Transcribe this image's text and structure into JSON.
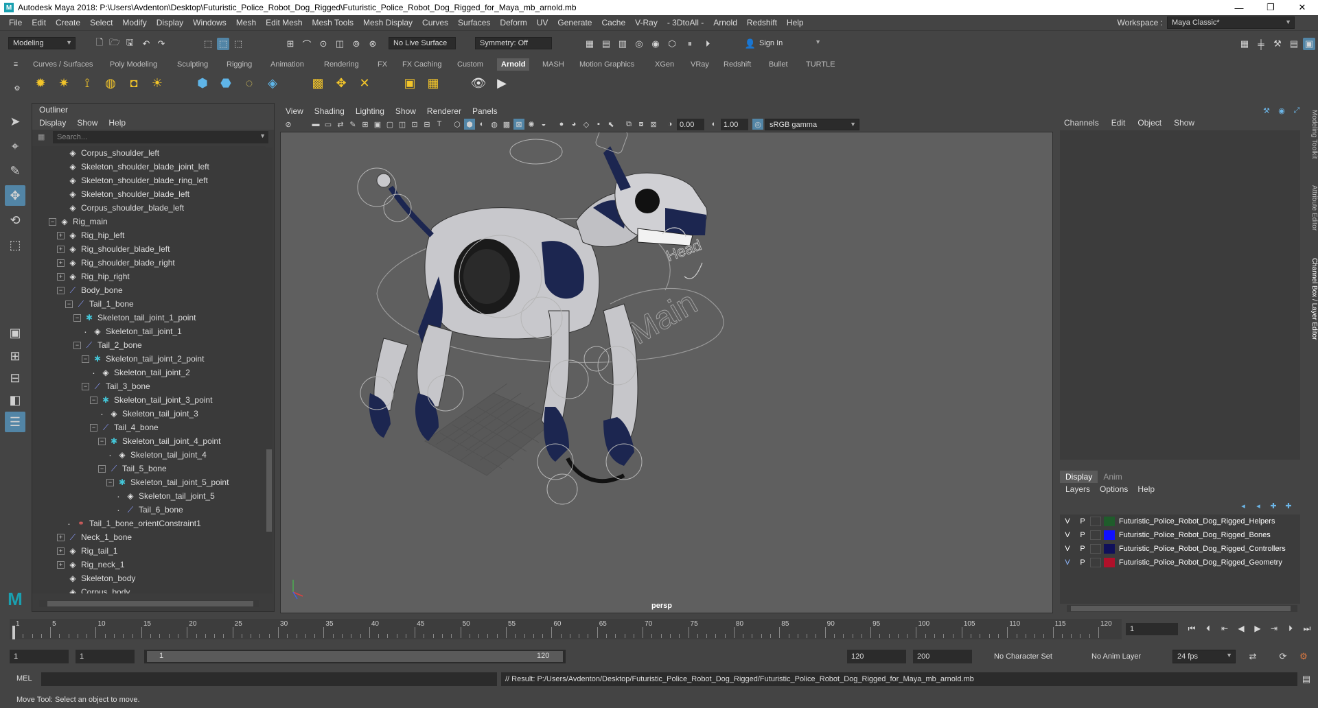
{
  "window": {
    "title": "Autodesk Maya 2018: P:\\Users\\Avdenton\\Desktop\\Futuristic_Police_Robot_Dog_Rigged\\Futuristic_Police_Robot_Dog_Rigged_for_Maya_mb_arnold.mb",
    "app_icon": "M",
    "minimize": "—",
    "maximize": "❐",
    "close": "✕"
  },
  "menubar": {
    "items": [
      "File",
      "Edit",
      "Create",
      "Select",
      "Modify",
      "Display",
      "Windows",
      "Mesh",
      "Edit Mesh",
      "Mesh Tools",
      "Mesh Display",
      "Curves",
      "Surfaces",
      "Deform",
      "UV",
      "Generate",
      "Cache",
      "V-Ray",
      "- 3DtoAll -",
      "Arnold",
      "Redshift",
      "Help"
    ],
    "workspace_label": "Workspace :",
    "workspace_value": "Maya Classic*"
  },
  "statusline": {
    "menuset": "Modeling",
    "live_surface": "No Live Surface",
    "symmetry": "Symmetry: Off",
    "sign_in": "Sign In"
  },
  "shelf": {
    "tabs": [
      "Curves / Surfaces",
      "Poly Modeling",
      "Sculpting",
      "Rigging",
      "Animation",
      "Rendering",
      "FX",
      "FX Caching",
      "Custom",
      "Arnold",
      "MASH",
      "Motion Graphics",
      "XGen",
      "VRay",
      "Redshift",
      "Bullet",
      "TURTLE"
    ],
    "active_tab": "Arnold"
  },
  "outliner": {
    "title": "Outliner",
    "menu": [
      "Display",
      "Show",
      "Help"
    ],
    "search_placeholder": "Search...",
    "rows": [
      {
        "label": "Corpus_shoulder_left",
        "indent": 2,
        "exp": "",
        "icon": "xform"
      },
      {
        "label": "Skeleton_shoulder_blade_joint_left",
        "indent": 2,
        "exp": "",
        "icon": "xform"
      },
      {
        "label": "Skeleton_shoulder_blade_ring_left",
        "indent": 2,
        "exp": "",
        "icon": "xform"
      },
      {
        "label": "Skeleton_shoulder_blade_left",
        "indent": 2,
        "exp": "",
        "icon": "xform"
      },
      {
        "label": "Corpus_shoulder_blade_left",
        "indent": 2,
        "exp": "",
        "icon": "xform"
      },
      {
        "label": "Rig_main",
        "indent": 1,
        "exp": "−",
        "icon": "xform"
      },
      {
        "label": "Rig_hip_left",
        "indent": 2,
        "exp": "+",
        "icon": "xform"
      },
      {
        "label": "Rig_shoulder_blade_left",
        "indent": 2,
        "exp": "+",
        "icon": "xform"
      },
      {
        "label": "Rig_shoulder_blade_right",
        "indent": 2,
        "exp": "+",
        "icon": "xform"
      },
      {
        "label": "Rig_hip_right",
        "indent": 2,
        "exp": "+",
        "icon": "xform"
      },
      {
        "label": "Body_bone",
        "indent": 2,
        "exp": "−",
        "icon": "bone"
      },
      {
        "label": "Tail_1_bone",
        "indent": 3,
        "exp": "−",
        "icon": "bone"
      },
      {
        "label": "Skeleton_tail_joint_1_point",
        "indent": 4,
        "exp": "−",
        "icon": "point"
      },
      {
        "label": "Skeleton_tail_joint_1",
        "indent": 5,
        "exp": "·",
        "icon": "xform"
      },
      {
        "label": "Tail_2_bone",
        "indent": 4,
        "exp": "−",
        "icon": "bone"
      },
      {
        "label": "Skeleton_tail_joint_2_point",
        "indent": 5,
        "exp": "−",
        "icon": "point"
      },
      {
        "label": "Skeleton_tail_joint_2",
        "indent": 6,
        "exp": "·",
        "icon": "xform"
      },
      {
        "label": "Tail_3_bone",
        "indent": 5,
        "exp": "−",
        "icon": "bone"
      },
      {
        "label": "Skeleton_tail_joint_3_point",
        "indent": 6,
        "exp": "−",
        "icon": "point"
      },
      {
        "label": "Skeleton_tail_joint_3",
        "indent": 7,
        "exp": "·",
        "icon": "xform"
      },
      {
        "label": "Tail_4_bone",
        "indent": 6,
        "exp": "−",
        "icon": "bone"
      },
      {
        "label": "Skeleton_tail_joint_4_point",
        "indent": 7,
        "exp": "−",
        "icon": "point"
      },
      {
        "label": "Skeleton_tail_joint_4",
        "indent": 8,
        "exp": "·",
        "icon": "xform"
      },
      {
        "label": "Tail_5_bone",
        "indent": 7,
        "exp": "−",
        "icon": "bone"
      },
      {
        "label": "Skeleton_tail_joint_5_point",
        "indent": 8,
        "exp": "−",
        "icon": "point"
      },
      {
        "label": "Skeleton_tail_joint_5",
        "indent": 9,
        "exp": "·",
        "icon": "xform"
      },
      {
        "label": "Tail_6_bone",
        "indent": 9,
        "exp": "·",
        "icon": "bone"
      },
      {
        "label": "Tail_1_bone_orientConstraint1",
        "indent": 3,
        "exp": "·",
        "icon": "constr"
      },
      {
        "label": "Neck_1_bone",
        "indent": 2,
        "exp": "+",
        "icon": "bone"
      },
      {
        "label": "Rig_tail_1",
        "indent": 2,
        "exp": "+",
        "icon": "xform"
      },
      {
        "label": "Rig_neck_1",
        "indent": 2,
        "exp": "+",
        "icon": "xform"
      },
      {
        "label": "Skeleton_body",
        "indent": 2,
        "exp": "",
        "icon": "xform"
      },
      {
        "label": "Corpus_body",
        "indent": 2,
        "exp": "",
        "icon": "xform"
      }
    ]
  },
  "viewport": {
    "menu": [
      "View",
      "Shading",
      "Lighting",
      "Show",
      "Renderer",
      "Panels"
    ],
    "near_value": "0.00",
    "far_value": "1.00",
    "color_space": "sRGB gamma",
    "camera_label": "persp",
    "rig_labels": [
      "Main",
      "Head"
    ]
  },
  "channel_box": {
    "menu": [
      "Channels",
      "Edit",
      "Object",
      "Show"
    ],
    "side_tabs": [
      "Modeling Toolkit",
      "Attribute Editor",
      "Channel Box / Layer Editor"
    ]
  },
  "layer_editor": {
    "tabs": [
      "Display",
      "Anim"
    ],
    "menu": [
      "Layers",
      "Options",
      "Help"
    ],
    "layers": [
      {
        "v": "V",
        "p": "P",
        "name": "Futuristic_Police_Robot_Dog_Rigged_Helpers",
        "color": "#1f5c2b"
      },
      {
        "v": "V",
        "p": "P",
        "name": "Futuristic_Police_Robot_Dog_Rigged_Bones",
        "color": "#1010ff"
      },
      {
        "v": "V",
        "p": "P",
        "name": "Futuristic_Police_Robot_Dog_Rigged_Controllers",
        "color": "#10105a"
      },
      {
        "v": "V",
        "p": "P",
        "name": "Futuristic_Police_Robot_Dog_Rigged_Geometry",
        "color": "#b0102a"
      }
    ]
  },
  "timeline": {
    "ticks": [
      "1",
      "5",
      "10",
      "15",
      "20",
      "25",
      "30",
      "35",
      "40",
      "45",
      "50",
      "55",
      "60",
      "65",
      "70",
      "75",
      "80",
      "85",
      "90",
      "95",
      "100",
      "105",
      "110",
      "115",
      "120"
    ],
    "current_frame": "1"
  },
  "range": {
    "start": "1",
    "anim_start": "1",
    "slider_start": "1",
    "slider_end": "120",
    "end": "120",
    "anim_end": "200",
    "character_set": "No Character Set",
    "anim_layer": "No Anim Layer",
    "fps": "24 fps"
  },
  "command": {
    "lang": "MEL",
    "result": "// Result: P:/Users/Avdenton/Desktop/Futuristic_Police_Robot_Dog_Rigged/Futuristic_Police_Robot_Dog_Rigged_for_Maya_mb_arnold.mb"
  },
  "help_line": "Move Tool: Select an object to move."
}
